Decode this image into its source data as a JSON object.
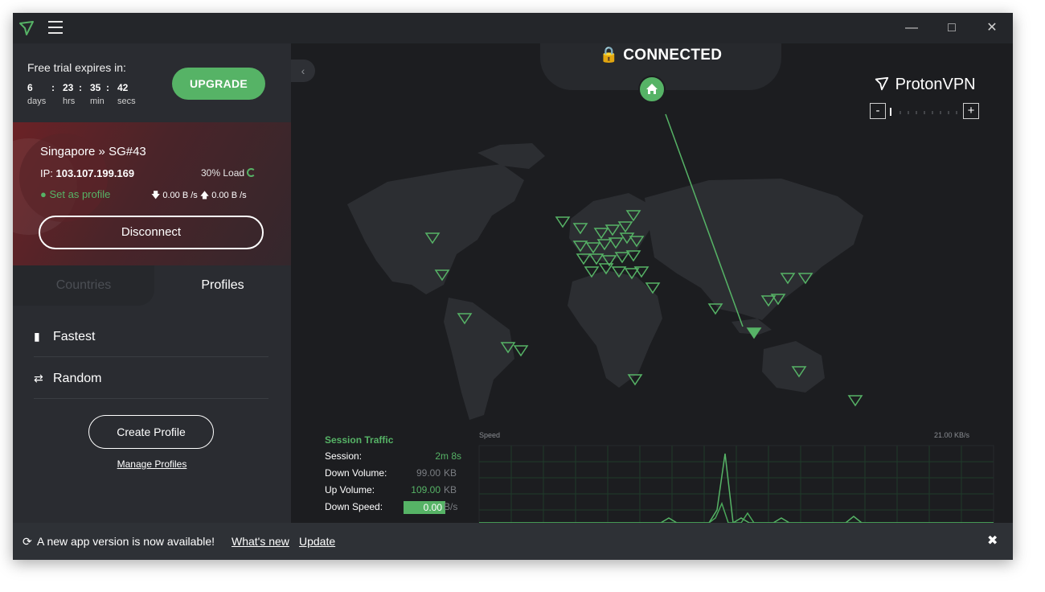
{
  "titlebar": {
    "minimize": "—",
    "maximize": "□",
    "close": "✕",
    "icons": [
      "proton-logo-icon",
      "hamburger-menu-icon"
    ]
  },
  "trial": {
    "label": "Free trial expires in:",
    "days": "6",
    "hours": "23",
    "minutes": "35",
    "seconds": "42",
    "sep": ":",
    "days_unit": "days",
    "hours_unit": "hrs",
    "minutes_unit": "min",
    "seconds_unit": "secs",
    "upgrade_label": "UPGRADE"
  },
  "server": {
    "name": "Singapore » SG#43",
    "ip_label": "IP:",
    "ip": "103.107.199.169",
    "load": "30% Load",
    "set_profile": "Set as profile",
    "down_speed": "0.00 B /s",
    "up_speed": "0.00 B /s",
    "disconnect_label": "Disconnect"
  },
  "tabs": {
    "countries": "Countries",
    "profiles": "Profiles",
    "active": "Profiles"
  },
  "profiles": {
    "items": [
      {
        "label": "Fastest",
        "icon": "signal-bars-icon"
      },
      {
        "label": "Random",
        "icon": "shuffle-icon"
      }
    ],
    "create_label": "Create Profile",
    "manage_label": "Manage Profiles"
  },
  "status": {
    "connected": "CONNECTED",
    "brand": "ProtonVPN",
    "zoom_minus": "-",
    "zoom_plus": "+"
  },
  "traffic": {
    "title": "Session Traffic",
    "rows": [
      {
        "label": "Session:",
        "value": "2m 8s",
        "unit": ""
      },
      {
        "label": "Down Volume:",
        "value": "99.00",
        "unit": "KB"
      },
      {
        "label": "Up Volume:",
        "value": "109.00",
        "unit": "KB"
      },
      {
        "label": "Down Speed:",
        "value": "0.00",
        "unit": "B/s"
      }
    ],
    "chart_left_label": "Speed",
    "chart_right_label": "21.00 KB/s"
  },
  "banner": {
    "text": "A new app version is now available!",
    "whats_new": "What's new",
    "update": "Update",
    "close": "✖"
  },
  "colors": {
    "accent": "#56b366",
    "background": "#1c1d20",
    "sidebar": "#2a2c31",
    "titlebar": "#24262a"
  }
}
